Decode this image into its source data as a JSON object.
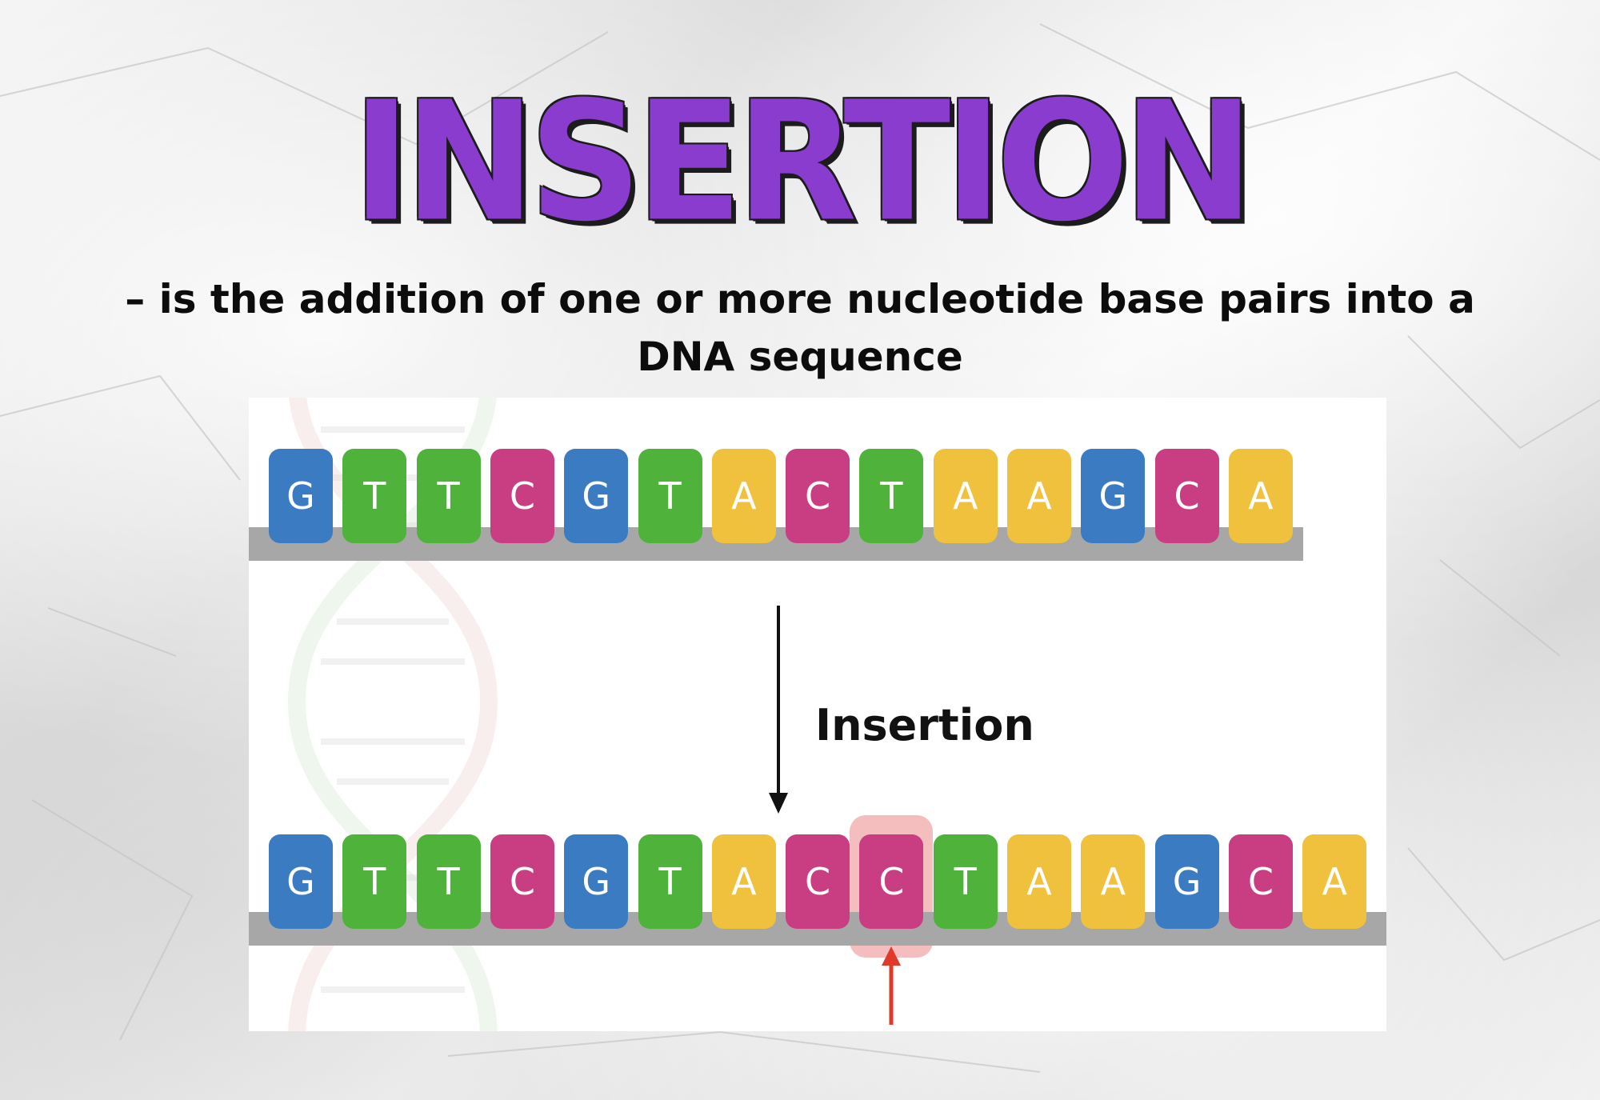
{
  "slide": {
    "title": "INSERTION",
    "definition_line1": "– is the addition of one or more nucleotide base pairs into a",
    "definition_line2": "DNA sequence"
  },
  "diagram": {
    "original_sequence": [
      "G",
      "T",
      "T",
      "C",
      "G",
      "T",
      "A",
      "C",
      "T",
      "A",
      "A",
      "G",
      "C",
      "A"
    ],
    "mutated_sequence": [
      "G",
      "T",
      "T",
      "C",
      "G",
      "T",
      "A",
      "C",
      "C",
      "T",
      "A",
      "A",
      "G",
      "C",
      "A"
    ],
    "inserted_index": 8,
    "arrow_label": "Insertion",
    "colors": {
      "G": "#3a7bc2",
      "T": "#4fb23a",
      "C": "#c93d83",
      "A": "#efc13c",
      "title": "#8a3ccf",
      "insertion_highlight": "#e66e6e",
      "insertion_arrow": "#e03a2a"
    }
  }
}
